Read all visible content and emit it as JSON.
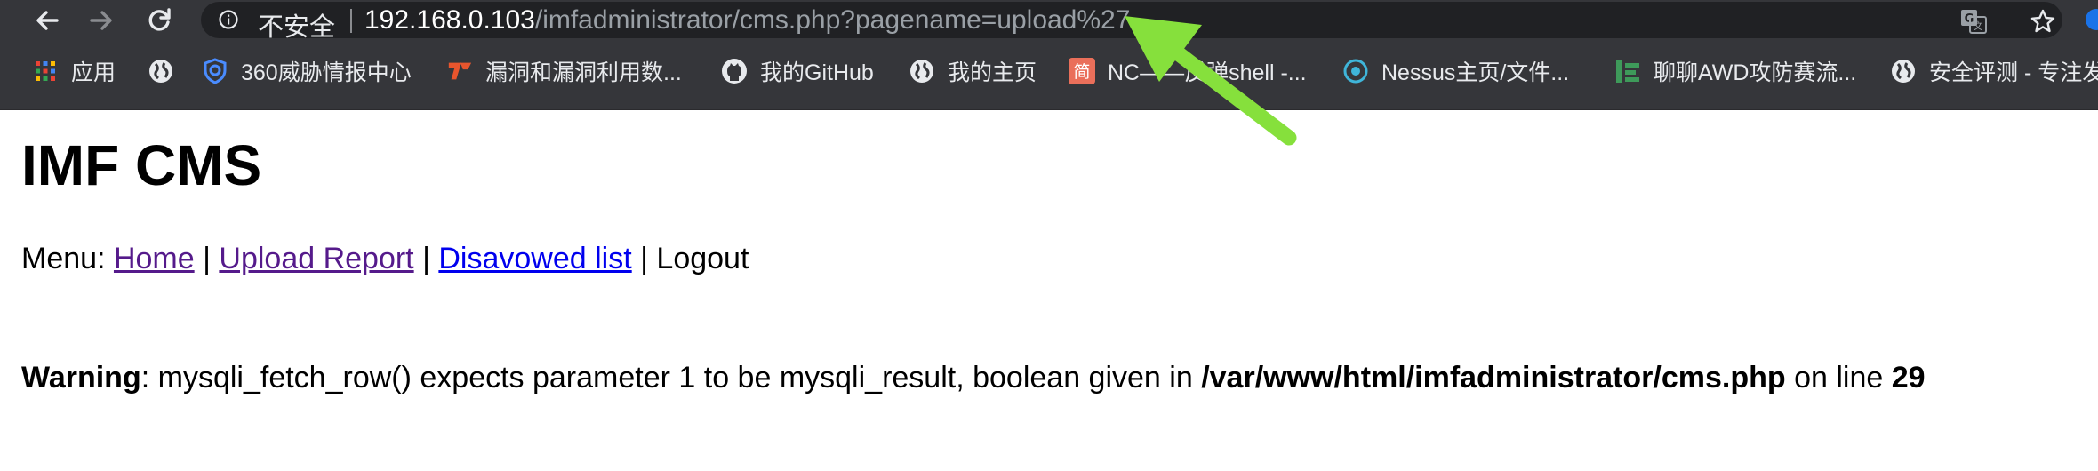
{
  "browser": {
    "security_label": "不安全",
    "url_host": "192.168.0.103",
    "url_path": "/imfadministrator/cms.php?pagename=upload%27"
  },
  "bookmarks": [
    {
      "label": "应用",
      "icon": "apps-grid-icon"
    },
    {
      "label": "",
      "icon": "globe-icon"
    },
    {
      "label": "360威胁情报中心",
      "icon": "shield-360-icon"
    },
    {
      "label": "漏洞和漏洞利用数...",
      "icon": "exploit-db-icon"
    },
    {
      "label": "我的GitHub",
      "icon": "github-icon"
    },
    {
      "label": "我的主页",
      "icon": "globe-icon"
    },
    {
      "label": "NC——反弹shell -...",
      "icon": "jianshu-icon"
    },
    {
      "label": "Nessus主页/文件...",
      "icon": "nessus-icon"
    },
    {
      "label": "聊聊AWD攻防赛流...",
      "icon": "bars-icon"
    },
    {
      "label": "安全评测 - 专注发",
      "icon": "globe-icon"
    }
  ],
  "page": {
    "title": "IMF CMS",
    "menu_prefix": "Menu: ",
    "menu_home": "Home",
    "menu_upload": "Upload Report",
    "menu_disavowed": "Disavowed list",
    "menu_logout": "Logout",
    "menu_sep": " | ",
    "warning_label": "Warning",
    "warning_text": ": mysqli_fetch_row() expects parameter 1 to be mysqli_result, boolean given in ",
    "warning_path": "/var/www/html/imfadministrator/cms.php",
    "warning_line_text": " on line ",
    "warning_line": "29"
  },
  "colors": {
    "chrome_bg": "#35363a",
    "omnibox_bg": "#202124",
    "link_visited": "#551a8b",
    "link_unvisited": "#0000ee",
    "annotation_arrow": "#86e03c"
  }
}
